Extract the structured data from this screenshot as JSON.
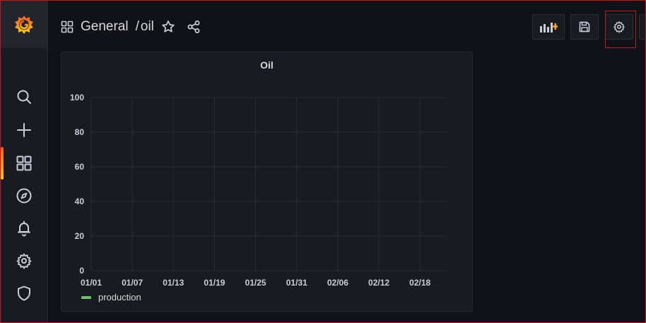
{
  "breadcrumb": {
    "folder": "General",
    "separator": "/",
    "title": "oil"
  },
  "toolbar": {
    "add_panel": "add-panel-icon",
    "save": "save-icon",
    "settings": "gear-icon"
  },
  "sidebar": {
    "items": [
      {
        "icon": "search-icon"
      },
      {
        "icon": "plus-icon"
      },
      {
        "icon": "dashboards-icon",
        "active": true
      },
      {
        "icon": "compass-icon"
      },
      {
        "icon": "bell-icon"
      },
      {
        "icon": "gear-icon"
      },
      {
        "icon": "shield-icon"
      }
    ]
  },
  "colors": {
    "accent": "#f05a28",
    "series": "#73bf69",
    "background": "#111217"
  },
  "panel": {
    "title": "Oil"
  },
  "chart_data": {
    "type": "line",
    "title": "Oil",
    "x_tick_labels": [
      "01/01",
      "01/07",
      "01/13",
      "01/19",
      "01/25",
      "01/31",
      "02/06",
      "02/12",
      "02/18"
    ],
    "y_tick_labels": [
      "0",
      "20",
      "40",
      "60",
      "80",
      "100"
    ],
    "ylim": [
      0,
      100
    ],
    "grid": true,
    "legend_position": "bottom-left",
    "series": [
      {
        "name": "production",
        "color": "#73bf69",
        "values": []
      }
    ]
  }
}
